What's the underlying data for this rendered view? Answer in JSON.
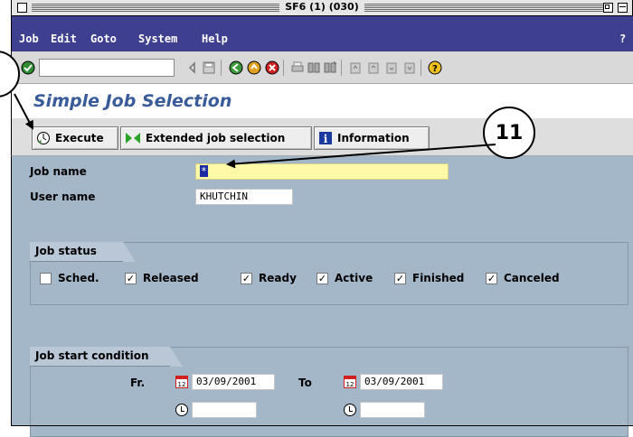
{
  "window": {
    "title": "SF6 (1) (030)"
  },
  "menu": {
    "items": [
      "Job",
      "Edit",
      "Goto",
      "System",
      "Help"
    ],
    "help_mark": "?"
  },
  "toolbar": {
    "command_field": {
      "value": "",
      "placeholder": ""
    },
    "icons": [
      "enter-icon",
      "back-arrow-icon",
      "save-icon",
      "back-icon",
      "exit-icon",
      "cancel-icon",
      "print-icon",
      "find-icon",
      "find-next-icon",
      "first-page-icon",
      "previous-page-icon",
      "next-page-icon",
      "last-page-icon",
      "help-icon"
    ]
  },
  "header": {
    "title": "Simple Job Selection"
  },
  "app_toolbar": {
    "execute_label": "Execute",
    "extended_label": "Extended job selection",
    "information_label": "Information"
  },
  "form": {
    "job_name_label": "Job name",
    "job_name_value": "*",
    "user_name_label": "User name",
    "user_name_value": "KHUTCHIN"
  },
  "job_status": {
    "title": "Job status",
    "options": [
      {
        "label": "Sched.",
        "checked": false
      },
      {
        "label": "Released",
        "checked": true
      },
      {
        "label": "Ready",
        "checked": true
      },
      {
        "label": "Active",
        "checked": true
      },
      {
        "label": "Finished",
        "checked": true
      },
      {
        "label": "Canceled",
        "checked": true
      }
    ]
  },
  "job_start": {
    "title": "Job start condition",
    "from_label": "Fr.",
    "from_date": "03/09/2001",
    "from_time": "",
    "to_label": "To",
    "to_date": "03/09/2001",
    "to_time": ""
  },
  "callout": {
    "number": "11"
  },
  "colors": {
    "menu_bg": "#3f3f8f",
    "main_bg": "#a4b7c9",
    "title_blue": "#3a5b9a",
    "job_name_field": "#fffaa8"
  }
}
